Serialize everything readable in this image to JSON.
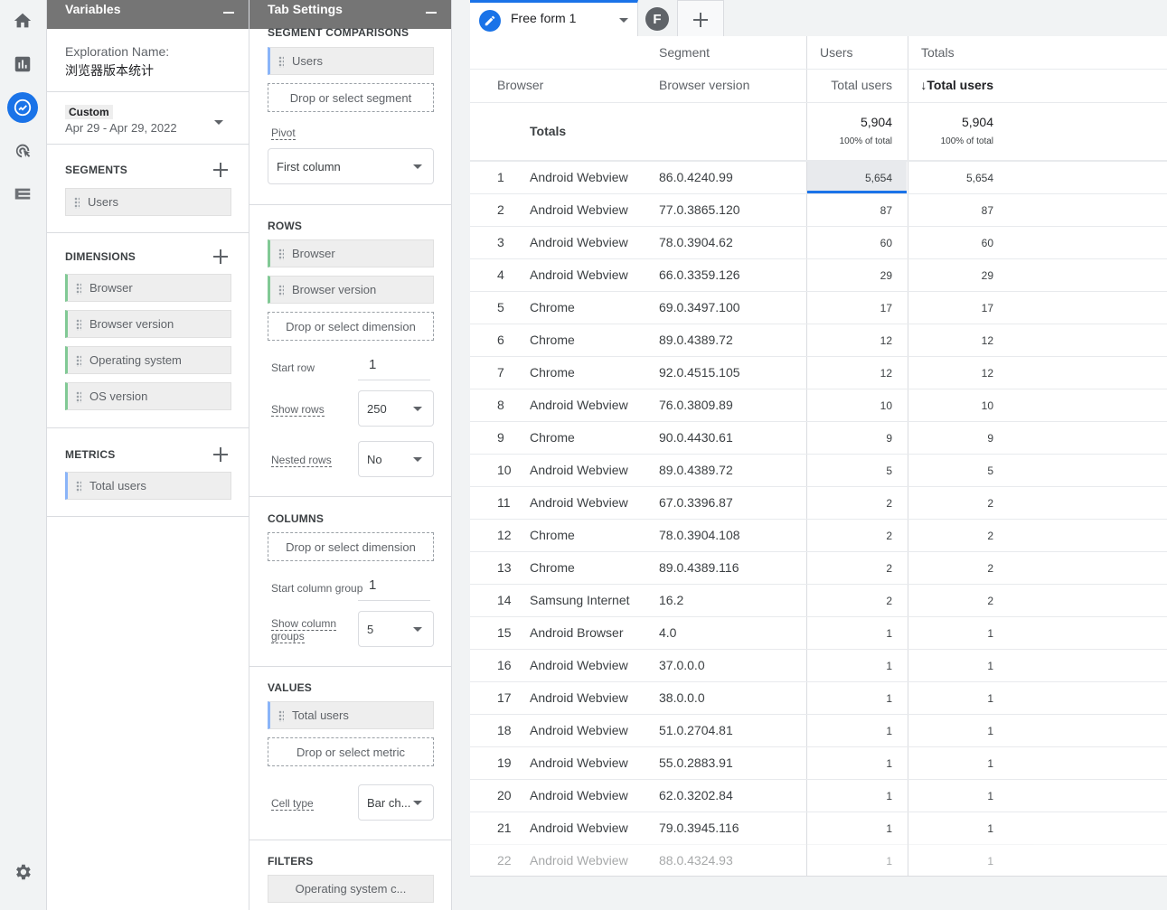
{
  "variables": {
    "title": "Variables",
    "exploration_label": "Exploration Name:",
    "exploration_name": "浏览器版本统计",
    "date_badge": "Custom",
    "date_range": "Apr 29 - Apr 29, 2022",
    "segments_title": "SEGMENTS",
    "segments": [
      "Users"
    ],
    "dimensions_title": "DIMENSIONS",
    "dimensions": [
      "Browser",
      "Browser version",
      "Operating system",
      "OS version"
    ],
    "metrics_title": "METRICS",
    "metrics": [
      "Total users"
    ]
  },
  "tab_settings": {
    "title": "Tab Settings",
    "segment_comparisons_title": "SEGMENT COMPARISONS",
    "segment_chip": "Users",
    "drop_segment": "Drop or select segment",
    "pivot_label": "Pivot",
    "pivot_value": "First column",
    "rows_title": "ROWS",
    "rows": [
      "Browser",
      "Browser version"
    ],
    "drop_dimension": "Drop or select dimension",
    "start_row_label": "Start row",
    "start_row_value": "1",
    "show_rows_label": "Show rows",
    "show_rows_value": "250",
    "nested_rows_label": "Nested rows",
    "nested_rows_value": "No",
    "columns_title": "COLUMNS",
    "drop_column_dimension": "Drop or select dimension",
    "start_column_group_label": "Start column group",
    "start_column_group_value": "1",
    "show_column_groups_label_1": "Show column",
    "show_column_groups_label_2": "groups",
    "show_column_groups_value": "5",
    "values_title": "VALUES",
    "values": [
      "Total users"
    ],
    "drop_metric": "Drop or select metric",
    "cell_type_label": "Cell type",
    "cell_type_value": "Bar ch...",
    "filters_title": "FILTERS",
    "filter_chip": "Operating system c..."
  },
  "tabs": {
    "active_tab": "Free form 1",
    "second_tab_letter": "F"
  },
  "table": {
    "header_segment": "Segment",
    "header_users": "Users",
    "header_totals": "Totals",
    "col_browser": "Browser",
    "col_browser_version": "Browser version",
    "col_total_users": "Total users",
    "col_total_users_sorted": "↓Total users",
    "totals_label": "Totals",
    "totals_users": "5,904",
    "totals_users_pct": "100% of total",
    "totals_totals": "5,904",
    "totals_totals_pct": "100% of total",
    "rows": [
      {
        "n": "1",
        "browser": "Android Webview",
        "version": "86.0.4240.99",
        "users": "5,654",
        "total": "5,654"
      },
      {
        "n": "2",
        "browser": "Android Webview",
        "version": "77.0.3865.120",
        "users": "87",
        "total": "87"
      },
      {
        "n": "3",
        "browser": "Android Webview",
        "version": "78.0.3904.62",
        "users": "60",
        "total": "60"
      },
      {
        "n": "4",
        "browser": "Android Webview",
        "version": "66.0.3359.126",
        "users": "29",
        "total": "29"
      },
      {
        "n": "5",
        "browser": "Chrome",
        "version": "69.0.3497.100",
        "users": "17",
        "total": "17"
      },
      {
        "n": "6",
        "browser": "Chrome",
        "version": "89.0.4389.72",
        "users": "12",
        "total": "12"
      },
      {
        "n": "7",
        "browser": "Chrome",
        "version": "92.0.4515.105",
        "users": "12",
        "total": "12"
      },
      {
        "n": "8",
        "browser": "Android Webview",
        "version": "76.0.3809.89",
        "users": "10",
        "total": "10"
      },
      {
        "n": "9",
        "browser": "Chrome",
        "version": "90.0.4430.61",
        "users": "9",
        "total": "9"
      },
      {
        "n": "10",
        "browser": "Android Webview",
        "version": "89.0.4389.72",
        "users": "5",
        "total": "5"
      },
      {
        "n": "11",
        "browser": "Android Webview",
        "version": "67.0.3396.87",
        "users": "2",
        "total": "2"
      },
      {
        "n": "12",
        "browser": "Chrome",
        "version": "78.0.3904.108",
        "users": "2",
        "total": "2"
      },
      {
        "n": "13",
        "browser": "Chrome",
        "version": "89.0.4389.116",
        "users": "2",
        "total": "2"
      },
      {
        "n": "14",
        "browser": "Samsung Internet",
        "version": "16.2",
        "users": "2",
        "total": "2"
      },
      {
        "n": "15",
        "browser": "Android Browser",
        "version": "4.0",
        "users": "1",
        "total": "1"
      },
      {
        "n": "16",
        "browser": "Android Webview",
        "version": "37.0.0.0",
        "users": "1",
        "total": "1"
      },
      {
        "n": "17",
        "browser": "Android Webview",
        "version": "38.0.0.0",
        "users": "1",
        "total": "1"
      },
      {
        "n": "18",
        "browser": "Android Webview",
        "version": "51.0.2704.81",
        "users": "1",
        "total": "1"
      },
      {
        "n": "19",
        "browser": "Android Webview",
        "version": "55.0.2883.91",
        "users": "1",
        "total": "1"
      },
      {
        "n": "20",
        "browser": "Android Webview",
        "version": "62.0.3202.84",
        "users": "1",
        "total": "1"
      },
      {
        "n": "21",
        "browser": "Android Webview",
        "version": "79.0.3945.116",
        "users": "1",
        "total": "1"
      },
      {
        "n": "22",
        "browser": "Android Webview",
        "version": "88.0.4324.93",
        "users": "1",
        "total": "1"
      }
    ]
  },
  "nav": {
    "items": [
      "home-icon",
      "reports-icon",
      "explore-icon",
      "advertising-icon",
      "configure-icon"
    ],
    "settings_icon": "gear-icon"
  },
  "colors": {
    "accent": "#1a73e8",
    "dimension_chip": "#81c995",
    "metric_chip": "#8ab4f8",
    "panel_header": "#757575"
  }
}
